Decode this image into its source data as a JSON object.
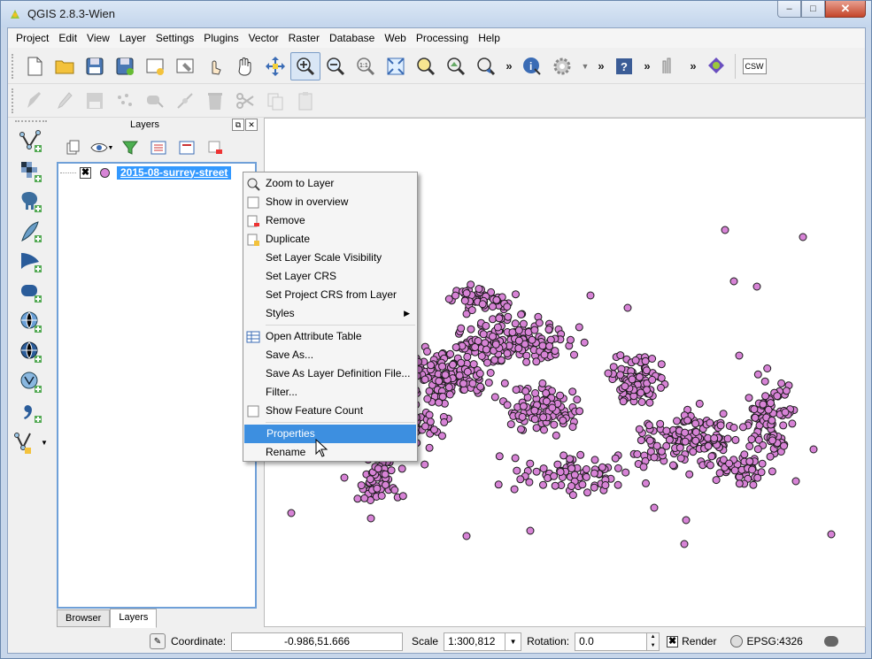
{
  "window": {
    "title": "QGIS 2.8.3-Wien",
    "buttons": [
      "‒",
      "□",
      "✕"
    ]
  },
  "menubar": [
    "Project",
    "Edit",
    "View",
    "Layer",
    "Settings",
    "Plugins",
    "Vector",
    "Raster",
    "Database",
    "Web",
    "Processing",
    "Help"
  ],
  "toolbar_overflow": "»",
  "toolbar_csw": "CSW",
  "layers_panel": {
    "title": "Layers",
    "float_btn": "⧉",
    "close_btn": "✕",
    "layer": {
      "name": "2015-08-surrey-street",
      "checked": "✖",
      "symbol_color": "#d784d6"
    },
    "tabs": [
      "Browser",
      "Layers"
    ]
  },
  "context_menu": {
    "items": [
      {
        "label": "Zoom to Layer",
        "icon": "zoom-layer-icon"
      },
      {
        "label": "Show in overview",
        "icon": "checkbox-icon"
      },
      {
        "label": "Remove",
        "icon": "remove-layer-icon"
      },
      {
        "label": "Duplicate",
        "icon": "duplicate-layer-icon"
      },
      {
        "label": "Set Layer Scale Visibility",
        "icon": ""
      },
      {
        "label": "Set Layer CRS",
        "icon": ""
      },
      {
        "label": "Set Project CRS from Layer",
        "icon": ""
      },
      {
        "label": "Styles",
        "icon": "",
        "submenu": "▶"
      },
      {
        "label": "Open Attribute Table",
        "icon": "table-icon"
      },
      {
        "label": "Save As...",
        "icon": ""
      },
      {
        "label": "Save As Layer Definition File...",
        "icon": ""
      },
      {
        "label": "Filter...",
        "icon": ""
      },
      {
        "label": "Show Feature Count",
        "icon": "checkbox-icon"
      },
      {
        "label": "Properties",
        "icon": "",
        "highlighted": true
      },
      {
        "label": "Rename",
        "icon": ""
      }
    ]
  },
  "statusbar": {
    "coordinate_label": "Coordinate:",
    "coordinate_value": "-0.986,51.666",
    "scale_label": "Scale",
    "scale_value": "1:300,812",
    "rotation_label": "Rotation:",
    "rotation_value": "0.0",
    "render_label": "Render",
    "render_checked": "✖",
    "crs": "EPSG:4326"
  },
  "map": {
    "point_color": "#d783d6"
  }
}
